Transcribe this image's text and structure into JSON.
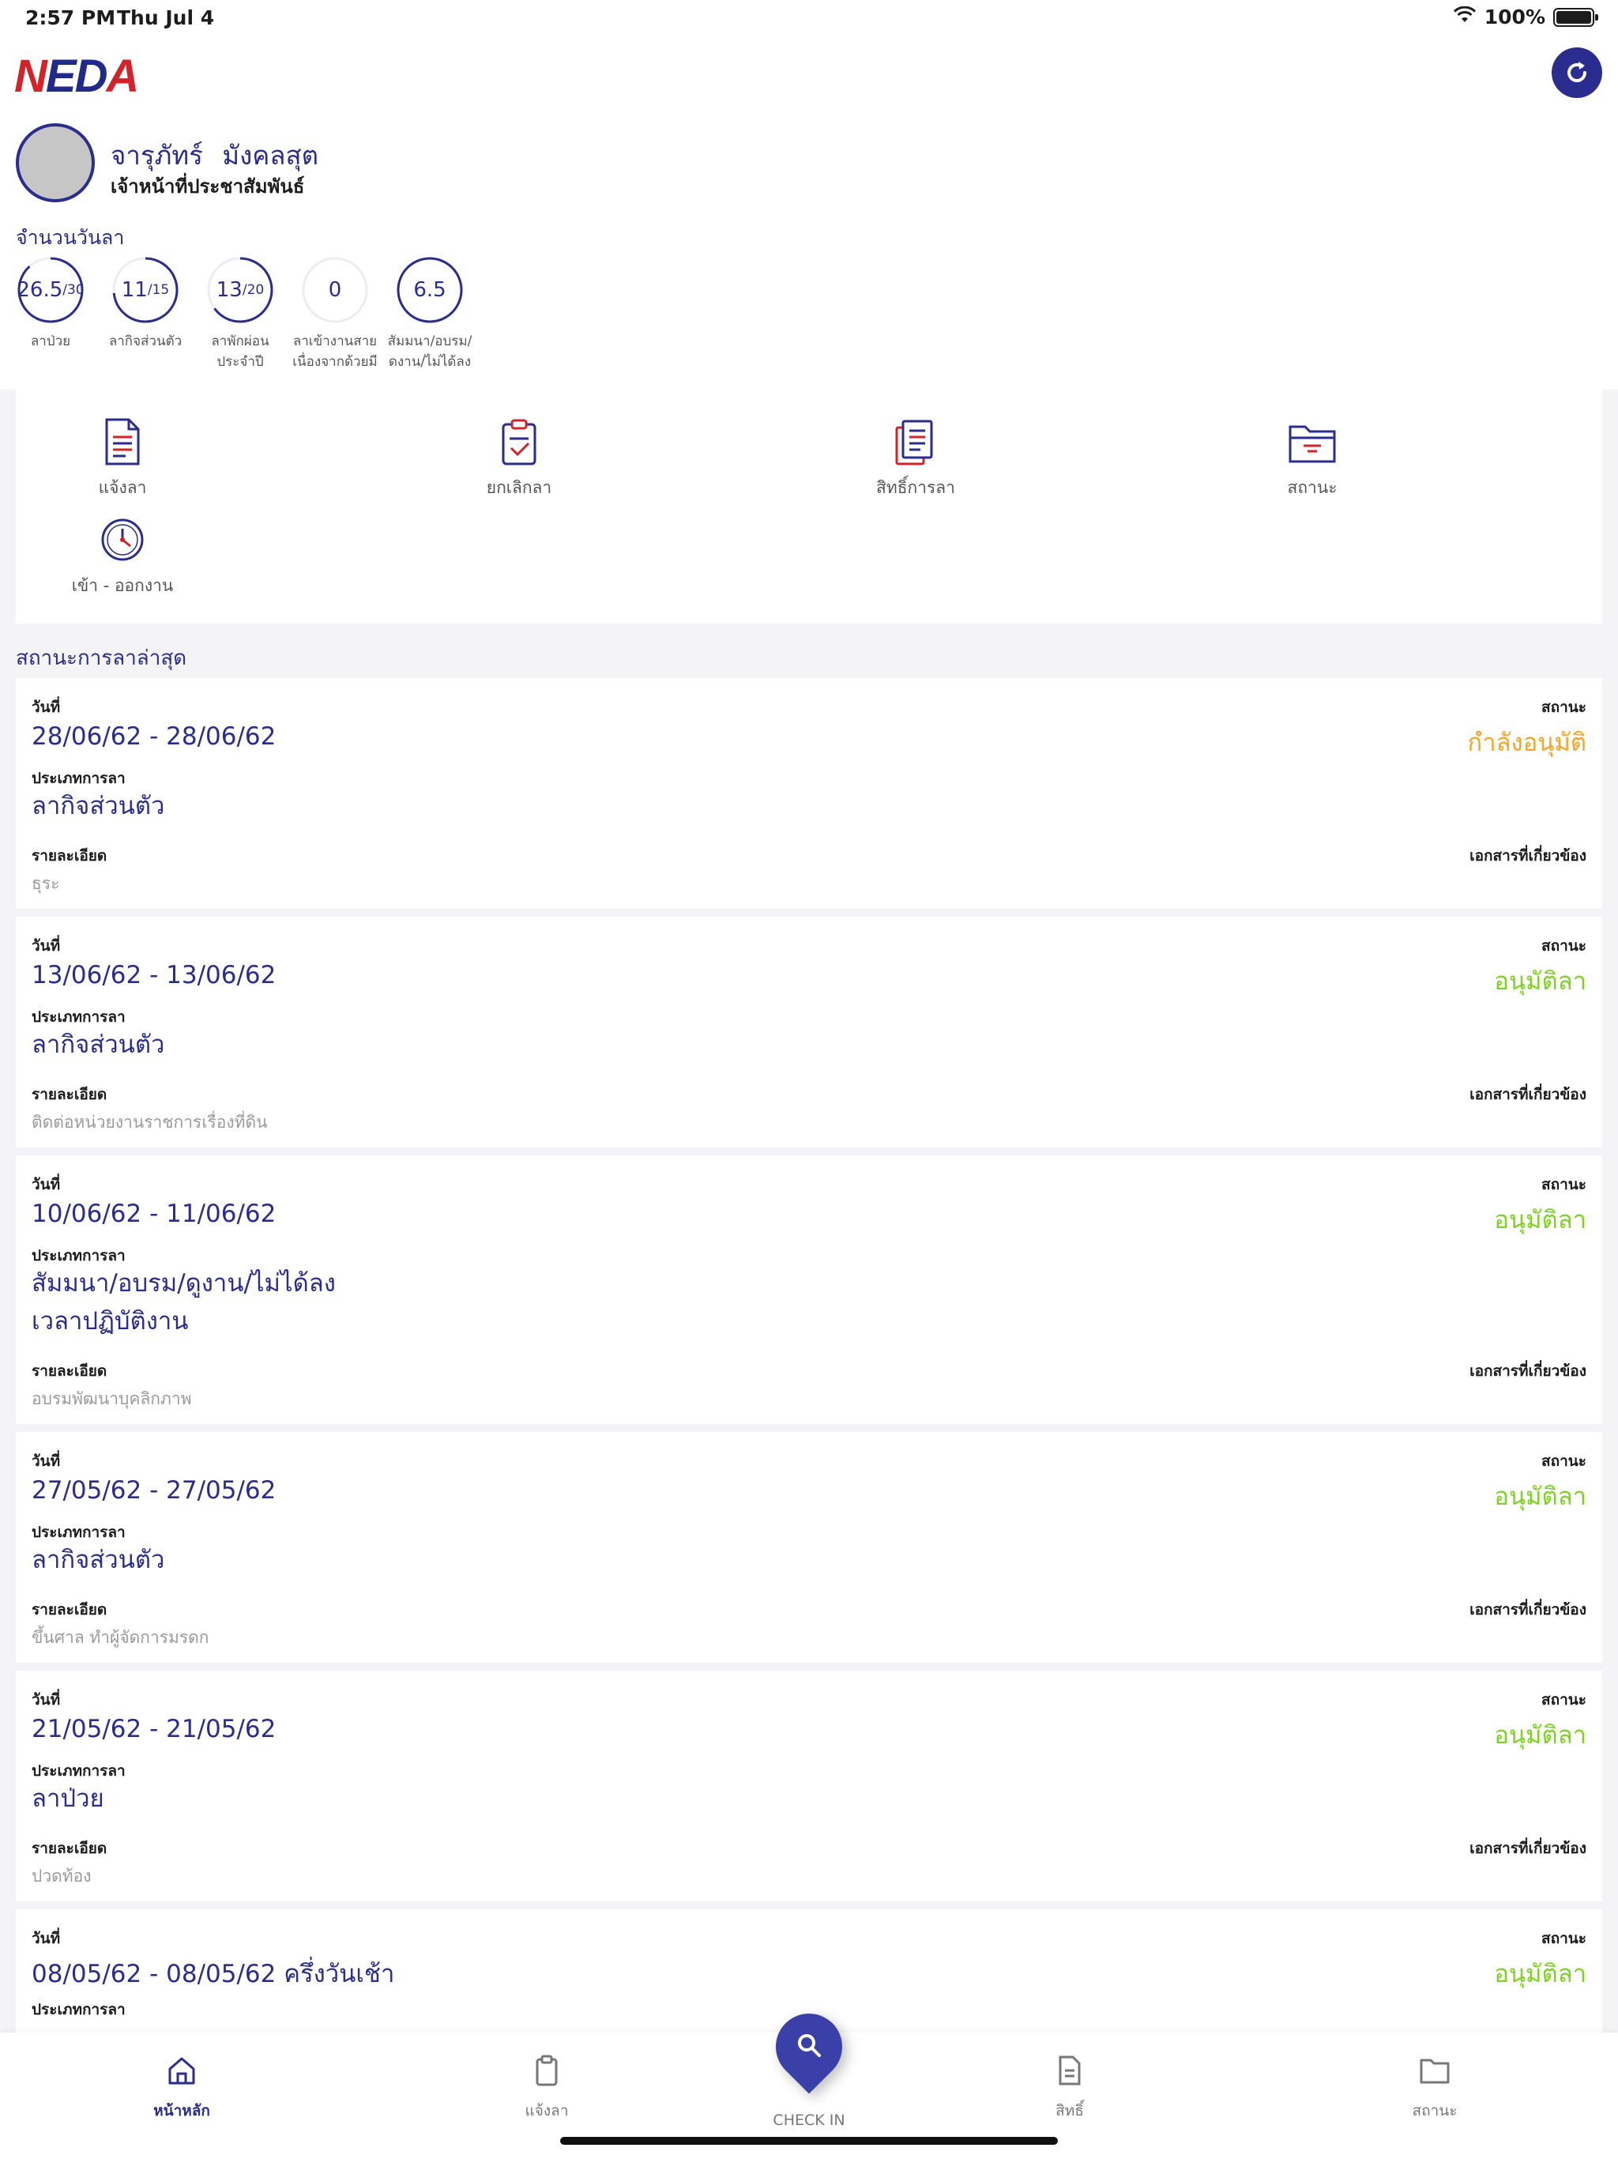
{
  "status_bar": {
    "time": "2:57 PM",
    "date": "Thu Jul 4",
    "battery": "100%"
  },
  "header": {
    "logo": "NEDA",
    "user_first_name": "จารุภัทร์",
    "user_last_name": "มังคลสุต",
    "user_role": "เจ้าหน้าที่ประชาสัมพันธ์"
  },
  "leave_quota": {
    "title": "จำนวนวันลา",
    "items": [
      {
        "value": "26.5",
        "total": "/30",
        "label1": "ลาป่วย",
        "label2": "",
        "fraction": 0.883
      },
      {
        "value": "11",
        "total": "/15",
        "label1": "ลากิจส่วนตัว",
        "label2": "",
        "fraction": 0.733
      },
      {
        "value": "13",
        "total": "/20",
        "label1": "ลาพักผ่อน",
        "label2": "ประจำปี",
        "fraction": 0.65
      },
      {
        "value": "0",
        "total": "",
        "label1": "ลาเข้างานสาย",
        "label2": "เนื่องจากด้วยมี",
        "fraction": 0
      },
      {
        "value": "6.5",
        "total": "",
        "label1": "สัมมนา/อบรม/",
        "label2": "ดงาน/ไม่ได้ลง",
        "fraction": 1
      }
    ]
  },
  "menu": {
    "items": [
      {
        "label": "แจ้งลา",
        "icon": "document-icon"
      },
      {
        "label": "ยกเลิกลา",
        "icon": "clipboard-icon"
      },
      {
        "label": "สิทธิ์การลา",
        "icon": "documents-icon"
      },
      {
        "label": "สถานะ",
        "icon": "folder-icon"
      },
      {
        "label": "เข้า - ออกงาน",
        "icon": "clock-icon"
      }
    ]
  },
  "recent": {
    "title": "สถานะการลาล่าสุด",
    "labels": {
      "date": "วันที่",
      "status": "สถานะ",
      "type": "ประเภทการลา",
      "detail": "รายละเอียด",
      "docs": "เอกสารที่เกี่ยวข้อง"
    },
    "cards": [
      {
        "date": "28/06/62 - 28/06/62",
        "status": "กำลังอนุมัติ",
        "type1": "ลากิจส่วนตัว",
        "type2": "",
        "detail": "ธุระ"
      },
      {
        "date": "13/06/62 - 13/06/62",
        "status": "อนุมัติลา",
        "type1": "ลากิจส่วนตัว",
        "type2": "",
        "detail": "ติดต่อหน่วยงานราชการเรื่องที่ดิน"
      },
      {
        "date": "10/06/62 - 11/06/62",
        "status": "อนุมัติลา",
        "type1": "สัมมนา/อบรม/ดูงาน/ไม่ได้ลง",
        "type2": "เวลาปฏิบัติงาน",
        "detail": "อบรมพัฒนาบุคลิกภาพ"
      },
      {
        "date": "27/05/62 - 27/05/62",
        "status": "อนุมัติลา",
        "type1": "ลากิจส่วนตัว",
        "type2": "",
        "detail": "ขึ้นศาล ทำผู้จัดการมรดก"
      },
      {
        "date": "21/05/62 - 21/05/62",
        "status": "อนุมัติลา",
        "type1": "ลาป่วย",
        "type2": "",
        "detail": "ปวดท้อง"
      },
      {
        "date": "08/05/62 - 08/05/62 ครึ่งวันเช้า",
        "status": "อนุมัติลา",
        "type1": "",
        "type2": "",
        "detail": ""
      }
    ]
  },
  "tabbar": {
    "home": "หน้าหลัก",
    "request": "แจ้งลา",
    "checkin": "CHECK IN",
    "rights": "สิทธิ์",
    "status": "สถานะ"
  },
  "colors": {
    "primary": "#2a2d8e",
    "pending": "#f5a623",
    "approved": "#7ed321"
  }
}
